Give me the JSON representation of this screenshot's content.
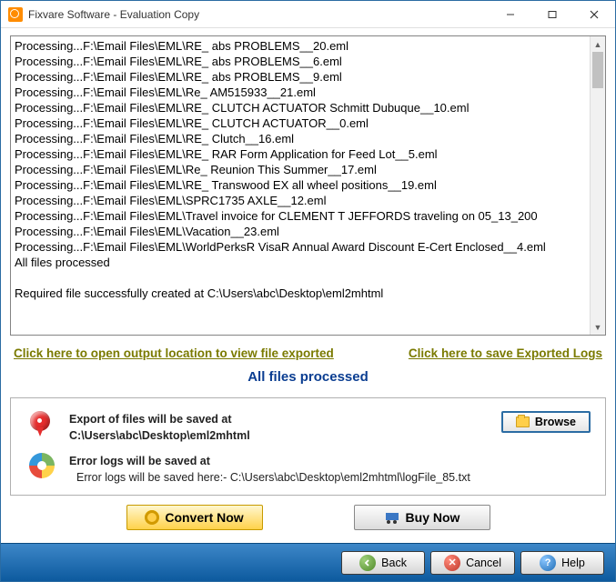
{
  "window": {
    "title": "Fixvare Software - Evaluation Copy"
  },
  "log_lines": [
    "Processing...F:\\Email Files\\EML\\RE_ abs PROBLEMS__20.eml",
    "Processing...F:\\Email Files\\EML\\RE_ abs PROBLEMS__6.eml",
    "Processing...F:\\Email Files\\EML\\RE_ abs PROBLEMS__9.eml",
    "Processing...F:\\Email Files\\EML\\Re_ AM515933__21.eml",
    "Processing...F:\\Email Files\\EML\\RE_ CLUTCH ACTUATOR Schmitt Dubuque__10.eml",
    "Processing...F:\\Email Files\\EML\\RE_ CLUTCH ACTUATOR__0.eml",
    "Processing...F:\\Email Files\\EML\\RE_ Clutch__16.eml",
    "Processing...F:\\Email Files\\EML\\RE_ RAR Form Application for Feed Lot__5.eml",
    "Processing...F:\\Email Files\\EML\\Re_ Reunion This Summer__17.eml",
    "Processing...F:\\Email Files\\EML\\RE_ Transwood EX all wheel positions__19.eml",
    "Processing...F:\\Email Files\\EML\\SPRC1735 AXLE__12.eml",
    "Processing...F:\\Email Files\\EML\\Travel invoice for CLEMENT T JEFFORDS traveling on 05_13_200",
    "Processing...F:\\Email Files\\EML\\Vacation__23.eml",
    "Processing...F:\\Email Files\\EML\\WorldPerksR VisaR Annual Award Discount E-Cert Enclosed__4.eml",
    "All files processed",
    "",
    "Required file successfully created at C:\\Users\\abc\\Desktop\\eml2mhtml"
  ],
  "links": {
    "open_output": "Click here to open output location to view file exported",
    "save_logs": "Click here to save Exported Logs"
  },
  "status_message": "All files processed",
  "panel": {
    "export_label": "Export of files will be saved at",
    "export_path": "C:\\Users\\abc\\Desktop\\eml2mhtml",
    "browse_label": "Browse",
    "error_label": "Error logs will be saved at",
    "error_detail": "Error logs will be saved here:- C:\\Users\\abc\\Desktop\\eml2mhtml\\logFile_85.txt"
  },
  "actions": {
    "convert": "Convert Now",
    "buy": "Buy Now"
  },
  "nav": {
    "back": "Back",
    "cancel": "Cancel",
    "help": "Help"
  }
}
